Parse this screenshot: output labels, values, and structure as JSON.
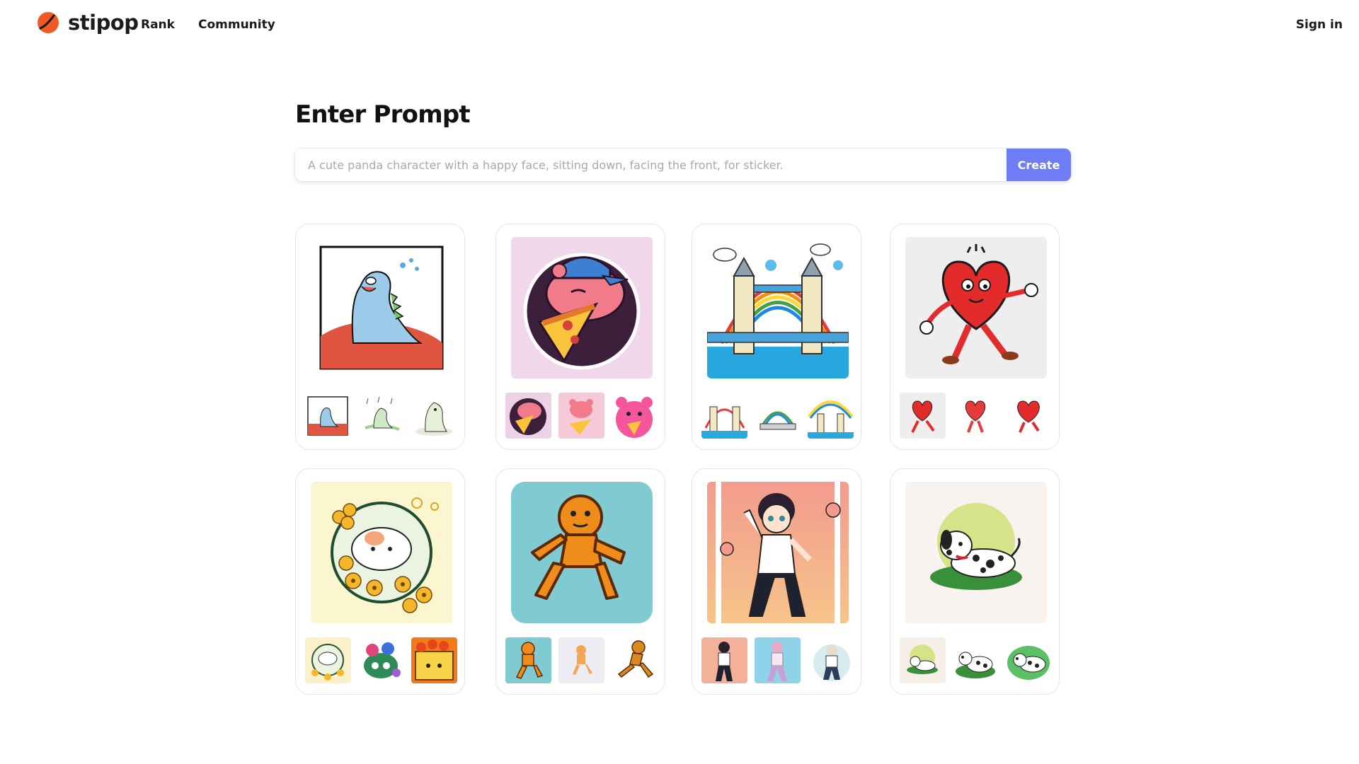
{
  "brand": {
    "name": "stipop",
    "logo_icon": "stipop-logo-icon",
    "color": "#f15a24"
  },
  "nav": {
    "rank": "Rank",
    "community": "Community",
    "sign_in": "Sign in"
  },
  "prompt": {
    "heading": "Enter Prompt",
    "placeholder": "A cute panda character with a happy face, sitting down, facing the front, for sticker.",
    "value": "",
    "create_label": "Create",
    "button_color": "#6e7cf6"
  },
  "cards": [
    {
      "theme": "dinosaur-sticker",
      "bg": "#ffffff"
    },
    {
      "theme": "bear-pizza-sticker",
      "bg": "#f1d7ea"
    },
    {
      "theme": "tower-bridge-rainbow-sticker",
      "bg": "#ffffff"
    },
    {
      "theme": "running-heart-sticker",
      "bg": "#eeeeee"
    },
    {
      "theme": "hamster-flowers-sticker",
      "bg": "#fbf6cf"
    },
    {
      "theme": "gingerbread-runner-sticker",
      "bg": "#7fcbd1"
    },
    {
      "theme": "dancing-boy-sticker",
      "bg": "#f3a48a"
    },
    {
      "theme": "dalmatian-puppy-sticker",
      "bg": "#f8f3ee"
    }
  ]
}
